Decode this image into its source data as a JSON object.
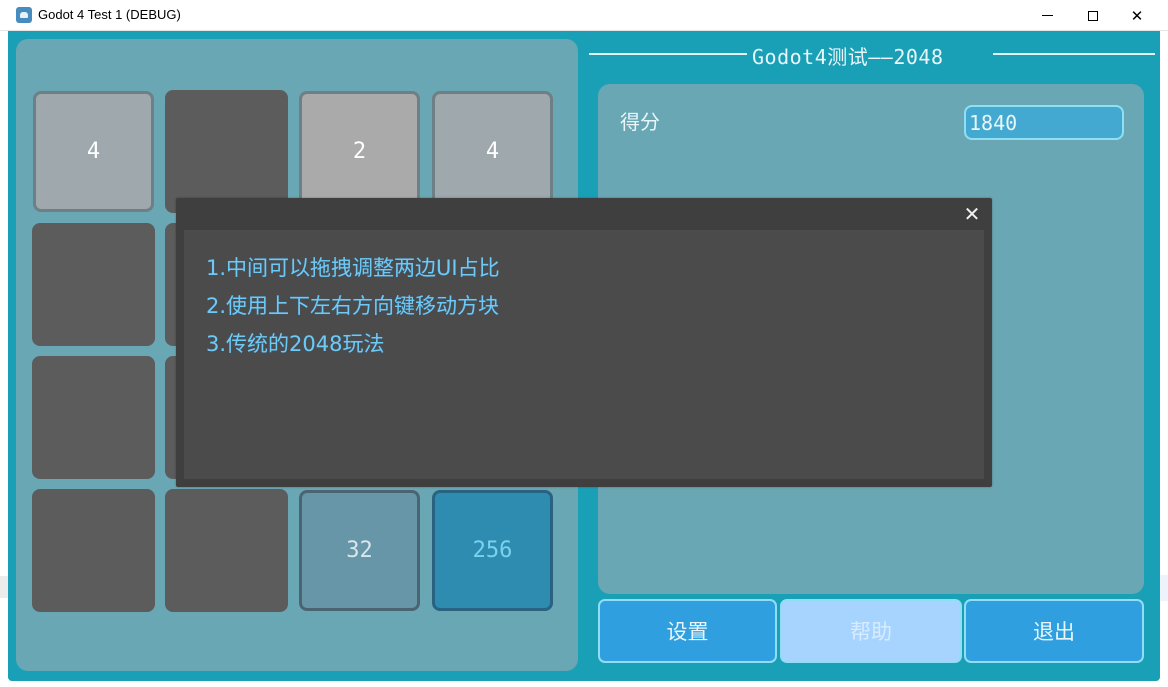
{
  "window": {
    "title": "Godot 4 Test 1 (DEBUG)",
    "min_glyph": "",
    "max_glyph": "",
    "close_glyph": "✕"
  },
  "header": {
    "title": "Godot4测试——2048"
  },
  "score": {
    "label": "得分",
    "value": "1840"
  },
  "board": {
    "rows": [
      [
        "4",
        "",
        "2",
        "4"
      ],
      [
        "",
        "",
        "",
        ""
      ],
      [
        "",
        "",
        "",
        ""
      ],
      [
        "",
        "",
        "32",
        "256"
      ]
    ]
  },
  "buttons": {
    "settings": "设置",
    "help": "帮助",
    "quit": "退出"
  },
  "dialog": {
    "close_glyph": "✕",
    "lines": [
      "1.中间可以拖拽调整两边UI占比",
      "2.使用上下左右方向键移动方块",
      "3.传统的2048玩法"
    ]
  },
  "colors": {
    "background": "#1aa0b6",
    "panel": "#6aa7b4",
    "button": "#2f9fe0",
    "button_pressed": "#a7d4ff",
    "dialog_text": "#6ec9f4"
  }
}
